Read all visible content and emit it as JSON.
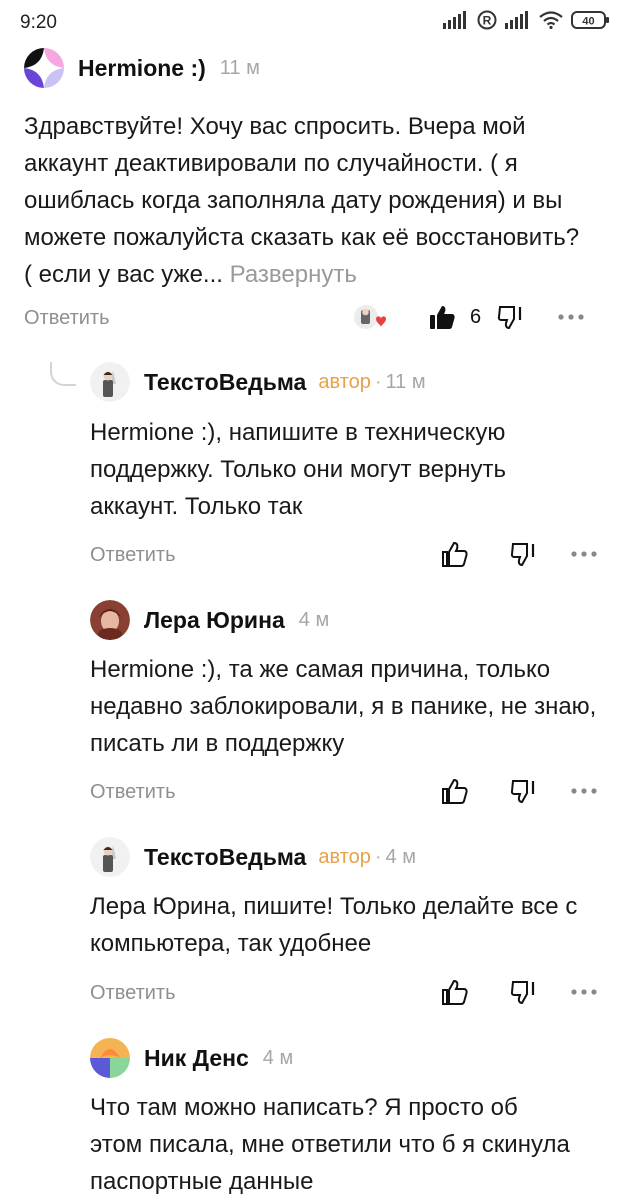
{
  "status_bar": {
    "time": "9:20",
    "battery": "40"
  },
  "comments": [
    {
      "author": "Hermione :)",
      "time": "11 м",
      "text": "Здравствуйте! Хочу вас спросить. Вчера мой аккаунт деактивировали по случайности. ( я ошиблась когда заполняла дату рождения) и вы можете пожалуйста сказать как её восстановить? ( если у вас уже...",
      "expand_label": "Развернуть",
      "reply_label": "Ответить",
      "like_count": "6"
    },
    {
      "author": "ТекстоВедьма",
      "badge": "автор",
      "dot": "·",
      "time": "11 м",
      "text": "Hermione :), напишите в техническую поддержку. Только они могут вернуть аккаунт. Только так",
      "reply_label": "Ответить"
    },
    {
      "author": "Лера Юрина",
      "time": "4 м",
      "text": "Hermione :), та же самая причина, только недавно заблокировали, я в панике, не знаю, писать ли в поддержку",
      "reply_label": "Ответить"
    },
    {
      "author": "ТекстоВедьма",
      "badge": "автор",
      "dot": "·",
      "time": "4 м",
      "text": "Лера Юрина, пишите! Только делайте все с компьютера, так удобнее",
      "reply_label": "Ответить"
    },
    {
      "author": "Ник Денс",
      "time": "4 м",
      "text": "Что там можно написать? Я просто об этом писала, мне ответили что б я скинула паспортные данные"
    }
  ],
  "icons": {
    "like": "thumbs-up-icon",
    "dislike": "thumbs-down-icon",
    "more": "more-dots-icon",
    "liked_by": "liked-by-author-icon"
  },
  "colors": {
    "badge": "#e8a04a",
    "secondary_text": "#8f8f8f",
    "heart": "#e8413c"
  }
}
